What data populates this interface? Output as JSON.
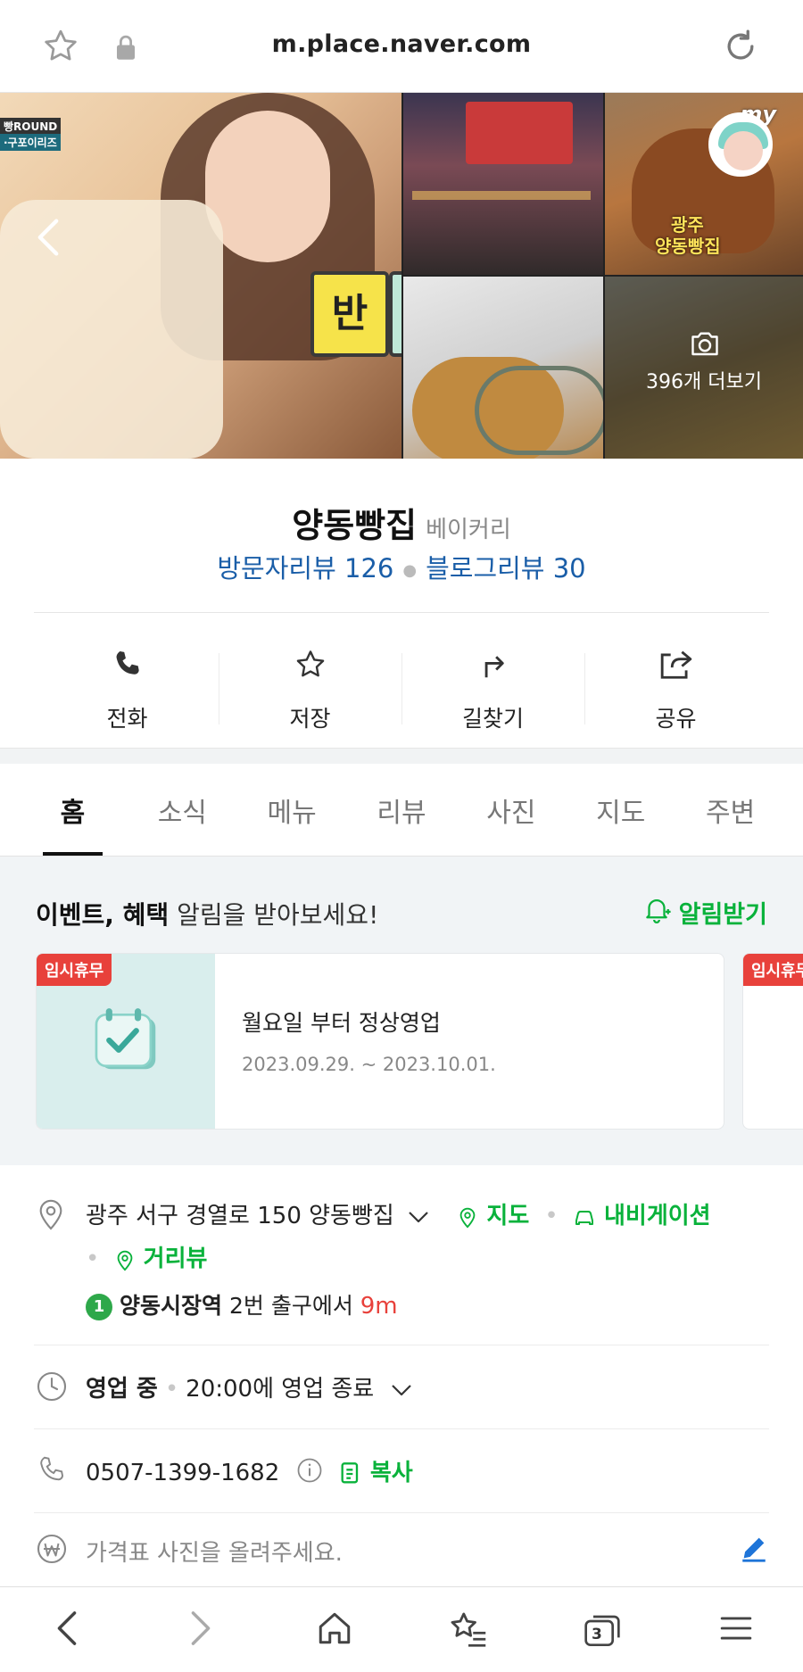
{
  "browser": {
    "url": "m.place.naver.com",
    "tab_count": "3",
    "icons": [
      "star-icon",
      "lock-icon",
      "reload-icon",
      "back-icon",
      "forward-icon",
      "home-icon",
      "bookmarks-icon",
      "tabs-icon",
      "menu-icon"
    ]
  },
  "gallery": {
    "more_label": "396개 더보기",
    "my_badge": "my",
    "tile_overlay_banner": "반",
    "tile3_caption_line1": "광주",
    "tile3_caption_line2": "양동빵집",
    "tile1_caption": "빵ROUND",
    "tile1_caption2": "·구포이리즈"
  },
  "place": {
    "name": "양동빵집",
    "category": "베이커리",
    "visitor_review_label": "방문자리뷰 126",
    "blog_review_label": "블로그리뷰 30"
  },
  "actions": [
    {
      "label": "전화",
      "icon": "phone-icon"
    },
    {
      "label": "저장",
      "icon": "star-outline-icon"
    },
    {
      "label": "길찾기",
      "icon": "directions-icon"
    },
    {
      "label": "공유",
      "icon": "share-icon"
    }
  ],
  "tabs": [
    {
      "label": "홈",
      "active": true
    },
    {
      "label": "소식",
      "active": false
    },
    {
      "label": "메뉴",
      "active": false
    },
    {
      "label": "리뷰",
      "active": false
    },
    {
      "label": "사진",
      "active": false
    },
    {
      "label": "지도",
      "active": false
    },
    {
      "label": "주변",
      "active": false
    }
  ],
  "notice": {
    "heading_bold": "이벤트, 혜택",
    "heading_rest": " 알림을 받아보세요!",
    "subscribe_label": "알림받기",
    "card": {
      "badge": "임시휴무",
      "title": "월요일 부터 정상영업",
      "date": "2023.09.29. ~ 2023.10.01."
    },
    "card2_badge": "임시휴무"
  },
  "details": {
    "address": "광주 서구 경열로 150 양동빵집",
    "map_label": "지도",
    "navigation_label": "내비게이션",
    "street_view_label": "거리뷰",
    "station_number": "1",
    "station_name": "양동시장역",
    "station_exit": " 2번 출구에서 ",
    "station_distance": "9m",
    "status": "영업 중",
    "hours": "20:00에 영업 종료",
    "phone": "0507-1399-1682",
    "copy_label": "복사",
    "price_prompt": "가격표 사진을 올려주세요."
  },
  "colors": {
    "accent_green": "#09b23b",
    "review_blue": "#1a5ea8",
    "badge_red": "#e8413b"
  }
}
